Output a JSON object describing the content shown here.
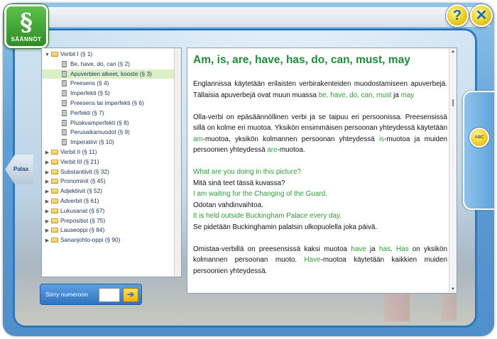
{
  "logo": {
    "mark": "§",
    "label": "SÄÄNNÖT"
  },
  "buttons": {
    "help": "?",
    "close": "✕",
    "back": "Palaa",
    "abc": "ABC"
  },
  "tree": [
    {
      "label": "Verbit I (§ 1)",
      "kind": "folder",
      "expanded": true
    },
    {
      "label": "Be, have, do, can (§ 2)",
      "kind": "doc"
    },
    {
      "label": "Apuverbien alkeet, kooste (§ 3)",
      "kind": "doc",
      "selected": true
    },
    {
      "label": "Preesens (§ 4)",
      "kind": "doc"
    },
    {
      "label": "Imperfekti (§ 5)",
      "kind": "doc"
    },
    {
      "label": "Preesens tai imperfekti (§ 6)",
      "kind": "doc"
    },
    {
      "label": "Perfekti (§ 7)",
      "kind": "doc"
    },
    {
      "label": "Pluskvamperfekti (§ 8)",
      "kind": "doc"
    },
    {
      "label": "Perusaikamuodot (§ 9)",
      "kind": "doc"
    },
    {
      "label": "Imperatiivi (§ 10)",
      "kind": "doc"
    },
    {
      "label": "Verbit II (§ 11)",
      "kind": "folder"
    },
    {
      "label": "Verbit III (§ 21)",
      "kind": "folder"
    },
    {
      "label": "Substantiivit (§ 32)",
      "kind": "folder"
    },
    {
      "label": "Pronominit (§ 45)",
      "kind": "folder"
    },
    {
      "label": "Adjektiivit (§ 52)",
      "kind": "folder"
    },
    {
      "label": "Adverbit (§ 61)",
      "kind": "folder"
    },
    {
      "label": "Lukusanat (§ 67)",
      "kind": "folder"
    },
    {
      "label": "Prepositiot (§ 75)",
      "kind": "folder"
    },
    {
      "label": "Lauseoppi (§ 84)",
      "kind": "folder"
    },
    {
      "label": "Sananjohto-oppi (§ 90)",
      "kind": "folder"
    }
  ],
  "goto": {
    "label": "Siirry numeroon",
    "value": "",
    "button": "➔"
  },
  "content": {
    "title": "Am, is, are, have, has, do, can, must, may",
    "p1": {
      "text": "Englannissa käytetään erilaisten verbirakenteiden muodostamiseen apuverbejä. Tällaisia apuverbejä ovat muun muassa ",
      "g1": "be, have, do, can, must",
      "mid": " ja ",
      "g2": "may"
    },
    "p2": {
      "t1": "Olla-verbi on epäsäännöllinen verbi ja se taipuu eri persoonissa. Preesensissä sillä on kolme eri muotoa. Yksikön ensimmäisen persoonan yhteydessä käytetään ",
      "g1": "am",
      "t2": "-muotoa, yksikön kolmannen persoonan yhteydessä ",
      "g2": "is",
      "t3": "-muotoa ja muiden persoonien yhteydessä ",
      "g3": "are",
      "t4": "-muotoa."
    },
    "examples": [
      {
        "en": "What are you doing in this picture?",
        "fi": "Mitä sinä teet tässä kuvassa?"
      },
      {
        "en": "I am waiting for the Changing of the Guard.",
        "fi": "Odotan vahdinvaihtoa."
      },
      {
        "en": "It is held outside Buckingham Palace every day.",
        "fi": "Se pidetään Buckinghamin palatsin ulkopuolella joka päivä."
      }
    ],
    "p3": {
      "t1": "Omistaa-verbillä on preesensissä kaksi muotoa ",
      "g1": "have",
      "t2": " ja ",
      "g2": "has",
      "t3": ". ",
      "g3": "Has",
      "t4": " on yksikön kolmannen persoonan muoto. ",
      "g4": "Have",
      "t5": "-muotoa käytetään kaikkien muiden persoonien yhteydessä."
    }
  }
}
